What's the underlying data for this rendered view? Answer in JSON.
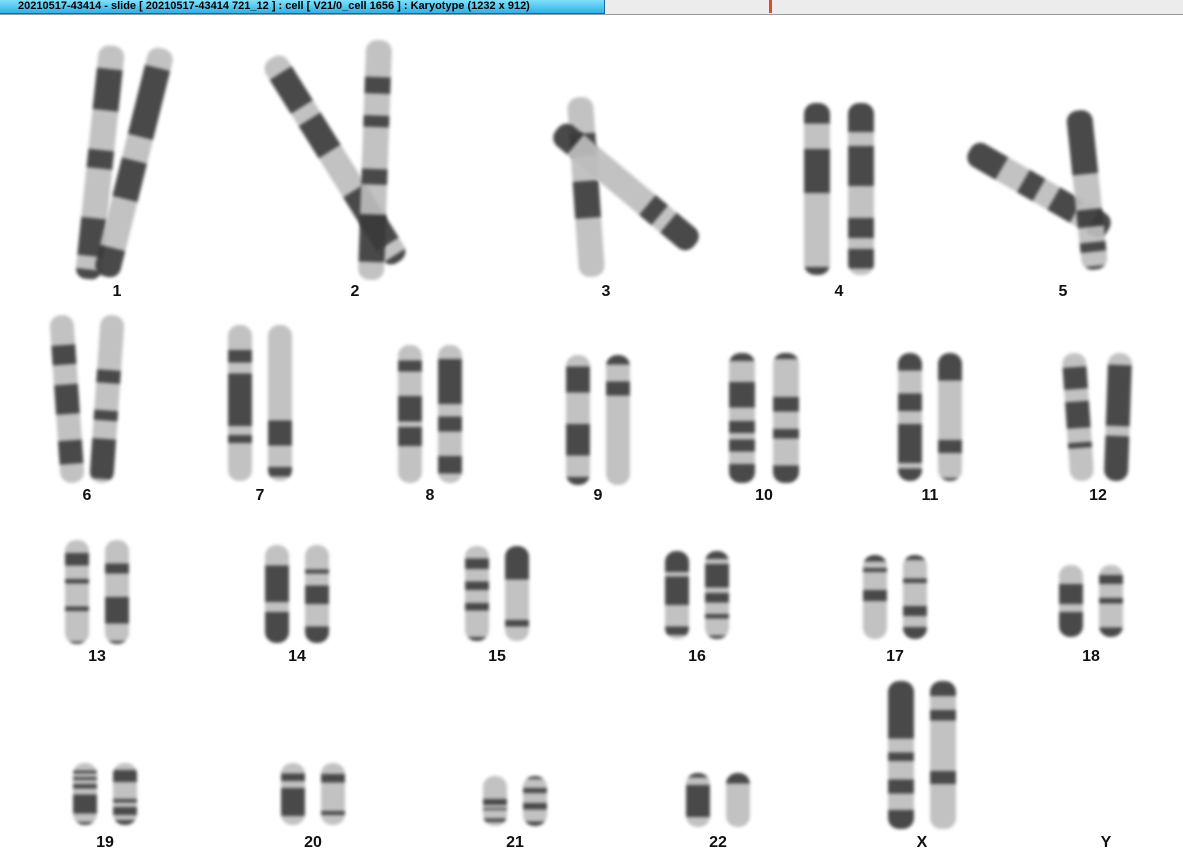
{
  "window": {
    "title": "20210517-43414 - slide [ 20210517-43414 721_12 ] : cell [ V21/0_cell 1656 ] : Karyotype  (1232 x 912)"
  },
  "karyotype": {
    "labels": [
      "1",
      "2",
      "3",
      "4",
      "5",
      "6",
      "7",
      "8",
      "9",
      "10",
      "11",
      "12",
      "13",
      "14",
      "15",
      "16",
      "17",
      "18",
      "19",
      "20",
      "21",
      "22",
      "X",
      "Y"
    ]
  },
  "colors": {
    "title_bar": "#2fb2e8",
    "chromosome_dark": "#3a3a3a",
    "chromosome_light": "#bdbdbd",
    "background": "#ffffff"
  }
}
